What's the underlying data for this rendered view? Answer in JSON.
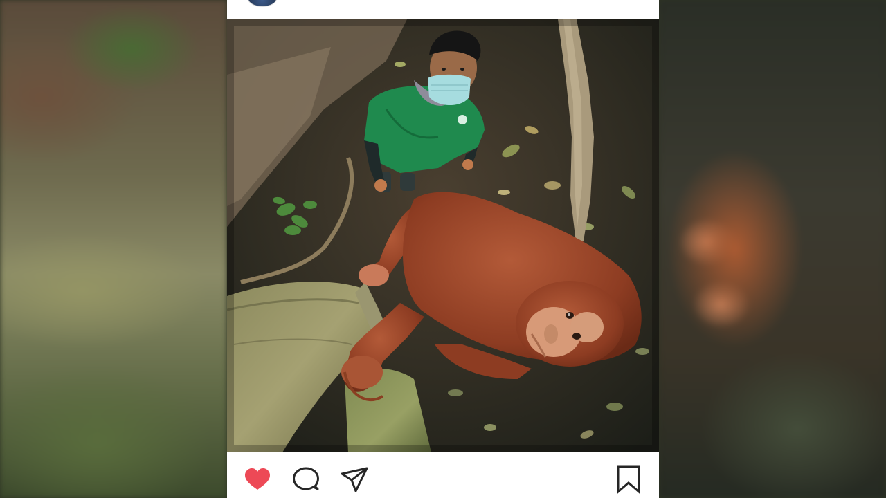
{
  "colors": {
    "like_heart": "#ed4956",
    "icon_stroke": "#262626",
    "card_background": "#ffffff"
  },
  "post": {
    "avatar": "profile-avatar",
    "photo": "orangutan-and-caretaker-photo",
    "actions": {
      "like": "heart-icon",
      "comment": "comment-bubble-icon",
      "share": "paper-plane-icon",
      "save": "bookmark-icon"
    },
    "liked": true
  }
}
